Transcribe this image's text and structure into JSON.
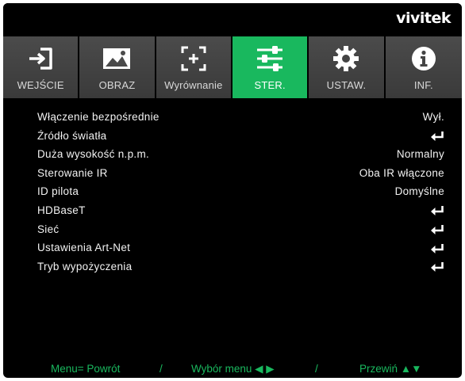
{
  "brand": {
    "logo_text": "vivitek"
  },
  "tabs": [
    {
      "label": "WEJŚCIE",
      "icon": "input-icon",
      "active": false
    },
    {
      "label": "OBRAZ",
      "icon": "picture-icon",
      "active": false
    },
    {
      "label": "Wyrównanie",
      "icon": "alignment-icon",
      "active": false
    },
    {
      "label": "STER.",
      "icon": "sliders-icon",
      "active": true
    },
    {
      "label": "USTAW.",
      "icon": "gear-icon",
      "active": false
    },
    {
      "label": "INF.",
      "icon": "info-icon",
      "active": false
    }
  ],
  "menu": {
    "items": [
      {
        "label": "Włączenie bezpośrednie",
        "value": "Wył.",
        "enter": false
      },
      {
        "label": "Źródło światła",
        "value": "",
        "enter": true
      },
      {
        "label": "Duża wysokość n.p.m.",
        "value": "Normalny",
        "enter": false
      },
      {
        "label": "Sterowanie IR",
        "value": "Oba IR włączone",
        "enter": false
      },
      {
        "label": "ID pilota",
        "value": "Domyślne",
        "enter": false
      },
      {
        "label": "HDBaseT",
        "value": "",
        "enter": true
      },
      {
        "label": "Sieć",
        "value": "",
        "enter": true
      },
      {
        "label": "Ustawienia Art-Net",
        "value": "",
        "enter": true
      },
      {
        "label": "Tryb wypożyczenia",
        "value": "",
        "enter": true
      }
    ]
  },
  "footer": {
    "menu_back": "Menu= Powrót",
    "sep1": "/",
    "select": "Wybór menu ◀ ▶",
    "sep2": "/",
    "scroll": "Przewiń ▲▼"
  },
  "colors": {
    "accent": "#19b85e",
    "background": "#000000",
    "tab_bg": "#444444",
    "text": "#f2f2f2"
  }
}
